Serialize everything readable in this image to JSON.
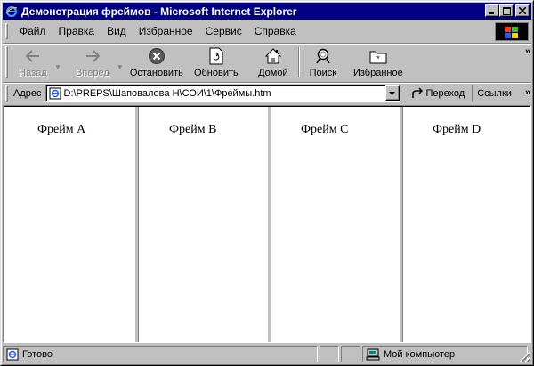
{
  "window": {
    "title": "Демонстрация фреймов - Microsoft Internet Explorer"
  },
  "menu": {
    "items": [
      {
        "label": "Файл",
        "access": "Ф"
      },
      {
        "label": "Правка",
        "access": "П"
      },
      {
        "label": "Вид",
        "access": "В"
      },
      {
        "label": "Избранное",
        "access": "И"
      },
      {
        "label": "Сервис",
        "access": "С"
      },
      {
        "label": "Справка",
        "access": "С"
      }
    ]
  },
  "toolbar": {
    "back": {
      "label": "Назад",
      "enabled": false,
      "icon": "arrow-left-icon"
    },
    "forward": {
      "label": "Вперед",
      "enabled": false,
      "icon": "arrow-right-icon"
    },
    "stop": {
      "label": "Остановить",
      "icon": "stop-icon"
    },
    "refresh": {
      "label": "Обновить",
      "icon": "refresh-icon"
    },
    "home": {
      "label": "Домой",
      "icon": "home-icon"
    },
    "search": {
      "label": "Поиск",
      "icon": "search-icon"
    },
    "favorites": {
      "label": "Избранное",
      "icon": "favorites-icon"
    }
  },
  "address_bar": {
    "label": "Адрес",
    "value": "D:\\PREPS\\Шаповалова Н\\СОИ\\1\\Фреймы.htm",
    "go_label": "Переход",
    "links_label": "Ссылки"
  },
  "frames": [
    {
      "label": "Фрейм A"
    },
    {
      "label": "Фрейм B"
    },
    {
      "label": "Фрейм C"
    },
    {
      "label": "Фрейм D"
    }
  ],
  "status_bar": {
    "text": "Готово",
    "zone": "Мой компьютер"
  },
  "colors": {
    "titlebar": "#000080",
    "chrome": "#c0c0c0",
    "content_bg": "#ffffff"
  }
}
